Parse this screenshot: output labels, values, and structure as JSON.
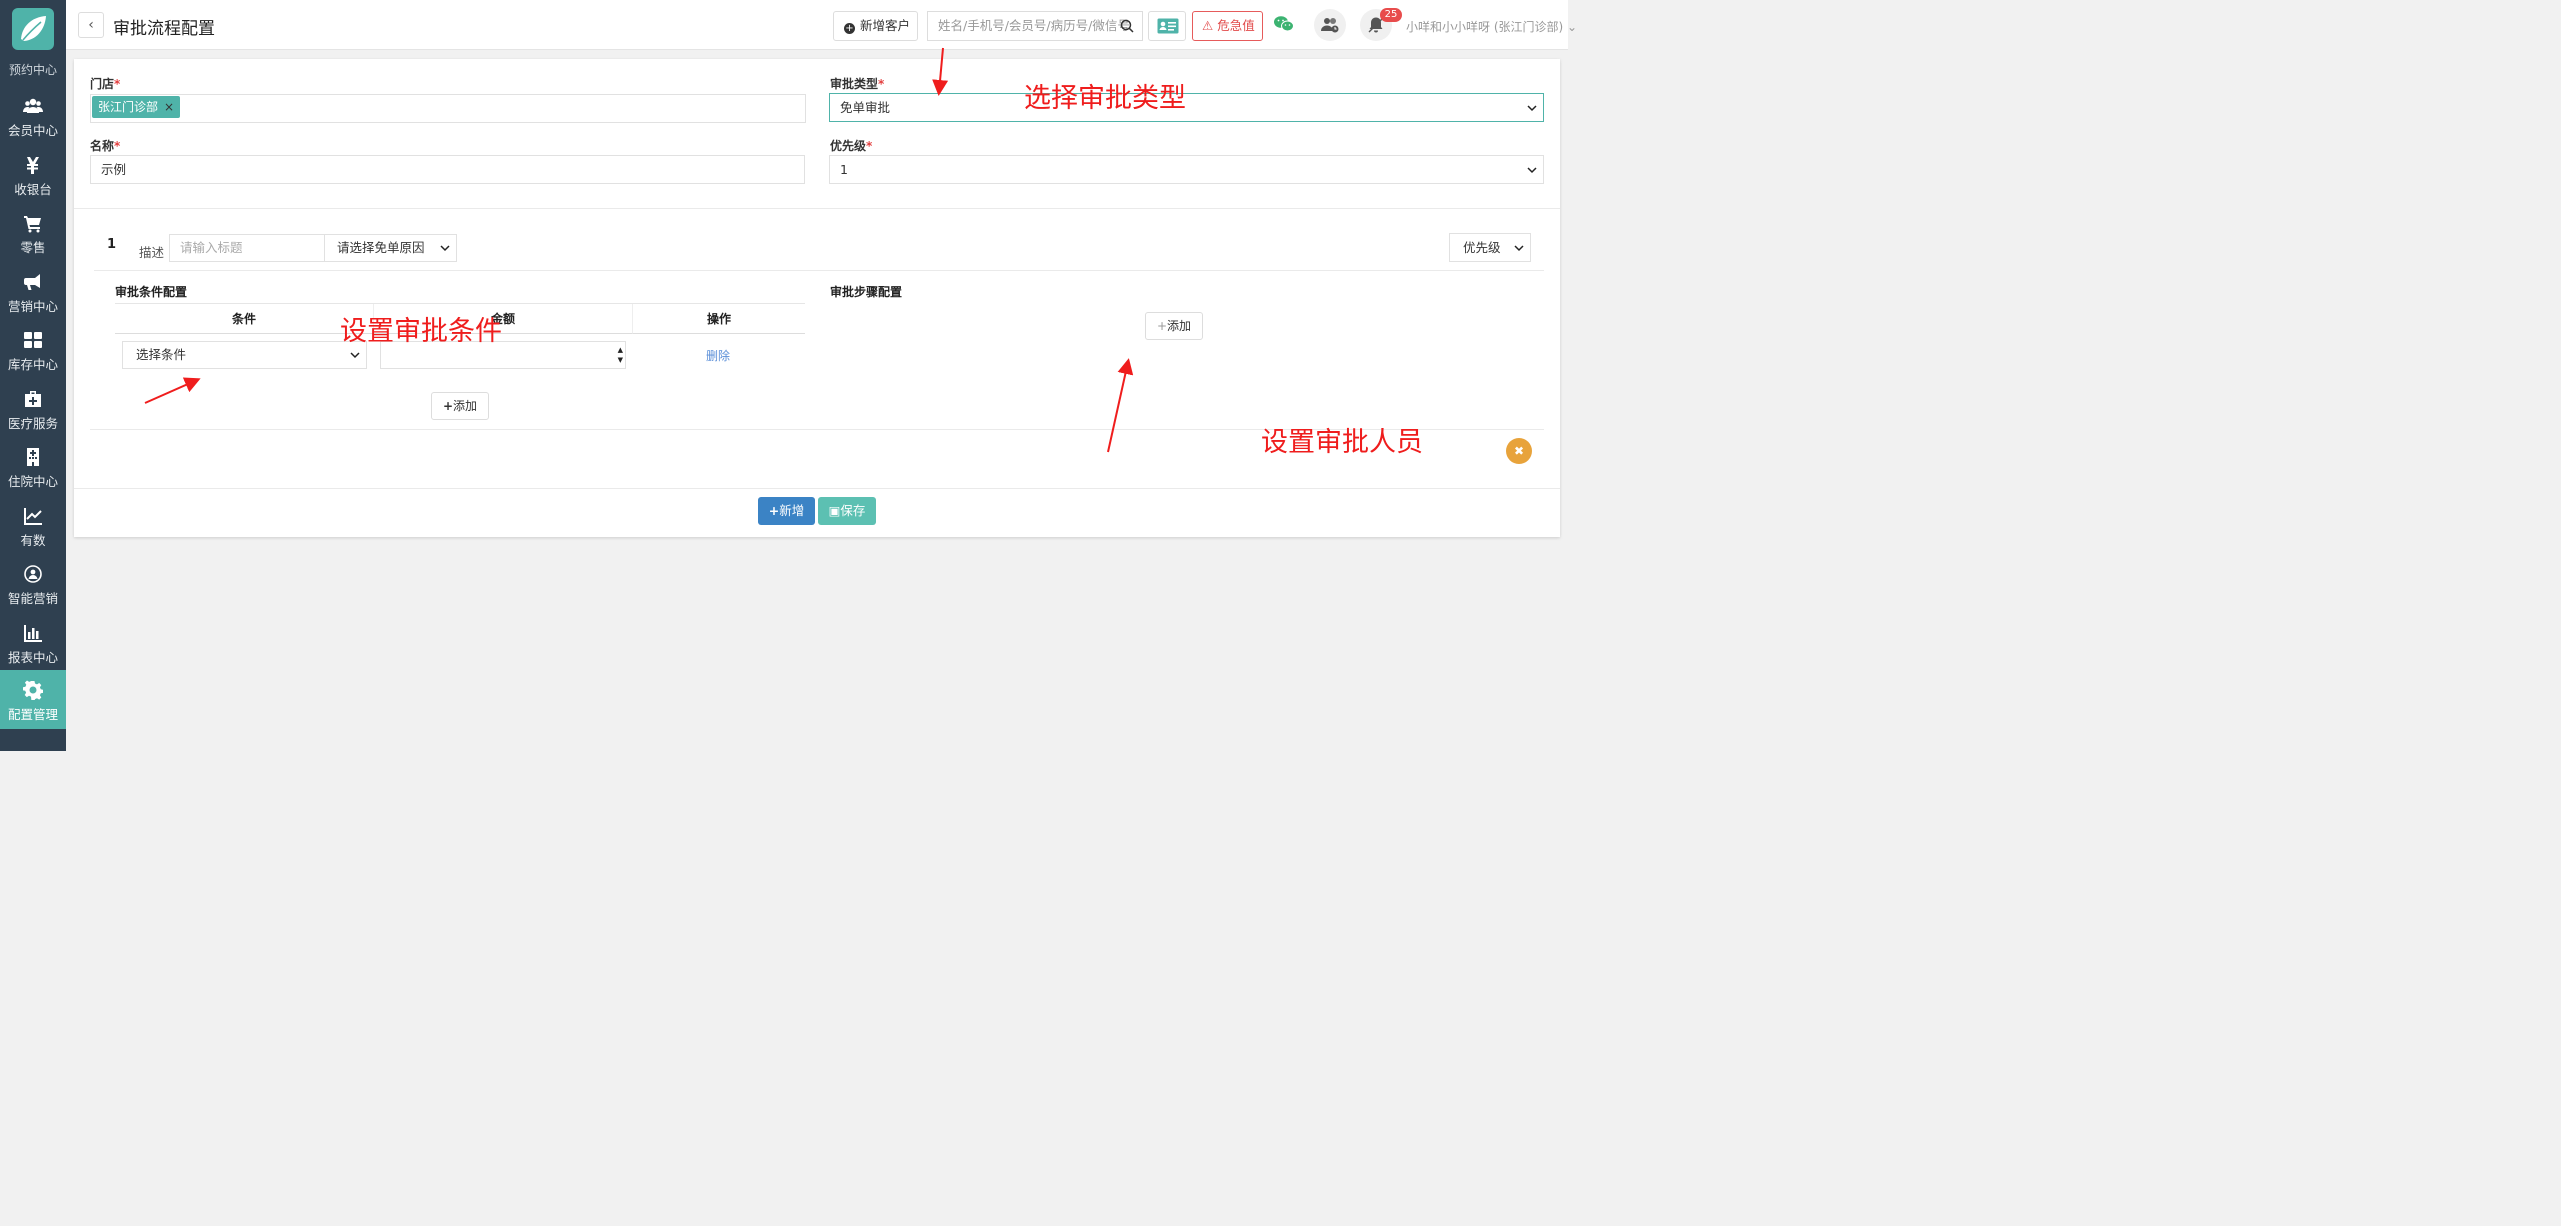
{
  "sidebar": {
    "partial_label": "预约中心",
    "items": [
      {
        "label": "会员中心",
        "icon": "members-icon"
      },
      {
        "label": "收银台",
        "icon": "yen-icon"
      },
      {
        "label": "零售",
        "icon": "cart-icon"
      },
      {
        "label": "营销中心",
        "icon": "megaphone-icon"
      },
      {
        "label": "库存中心",
        "icon": "grid-icon"
      },
      {
        "label": "医疗服务",
        "icon": "medkit-icon"
      },
      {
        "label": "住院中心",
        "icon": "hospital-icon"
      },
      {
        "label": "有数",
        "icon": "line-chart-icon"
      },
      {
        "label": "智能营销",
        "icon": "smart-marketing-icon"
      },
      {
        "label": "报表中心",
        "icon": "bar-chart-icon"
      },
      {
        "label": "配置管理",
        "icon": "gear-icon",
        "active": true
      }
    ]
  },
  "header": {
    "back": "‹",
    "title": "审批流程配置",
    "new_customer": "新增客户",
    "search_placeholder": "姓名/手机号/会员号/病历号/微信号",
    "critical_value": "危急值",
    "notification_count": "25",
    "user": "小咩和小小咩呀 (张江门诊部)"
  },
  "form": {
    "store_label": "门店",
    "store_tag": "张江门诊部",
    "approval_type_label": "审批类型",
    "approval_type_value": "免单审批",
    "name_label": "名称",
    "name_value": "示例",
    "priority_label": "优先级",
    "priority_value": "1"
  },
  "rule": {
    "index": "1",
    "desc_label": "描述",
    "title_placeholder": "请输入标题",
    "reason_placeholder": "请选择免单原因",
    "priority_select": "优先级",
    "conditions_title": "审批条件配置",
    "col_condition": "条件",
    "col_amount": "金额",
    "col_action": "操作",
    "condition_select": "选择条件",
    "delete": "删除",
    "add": "添加",
    "steps_title": "审批步骤配置",
    "steps_add": "添加"
  },
  "footer": {
    "new": "新增",
    "save": "保存"
  },
  "annotations": {
    "type": "选择审批类型",
    "conditions": "设置审批条件",
    "approvers": "设置审批人员"
  },
  "colors": {
    "accent": "#4fb3a9",
    "sidebar": "#2f4050",
    "danger": "#e24b4b",
    "primary": "#3b83c5",
    "annotation": "#ef1d1d"
  }
}
